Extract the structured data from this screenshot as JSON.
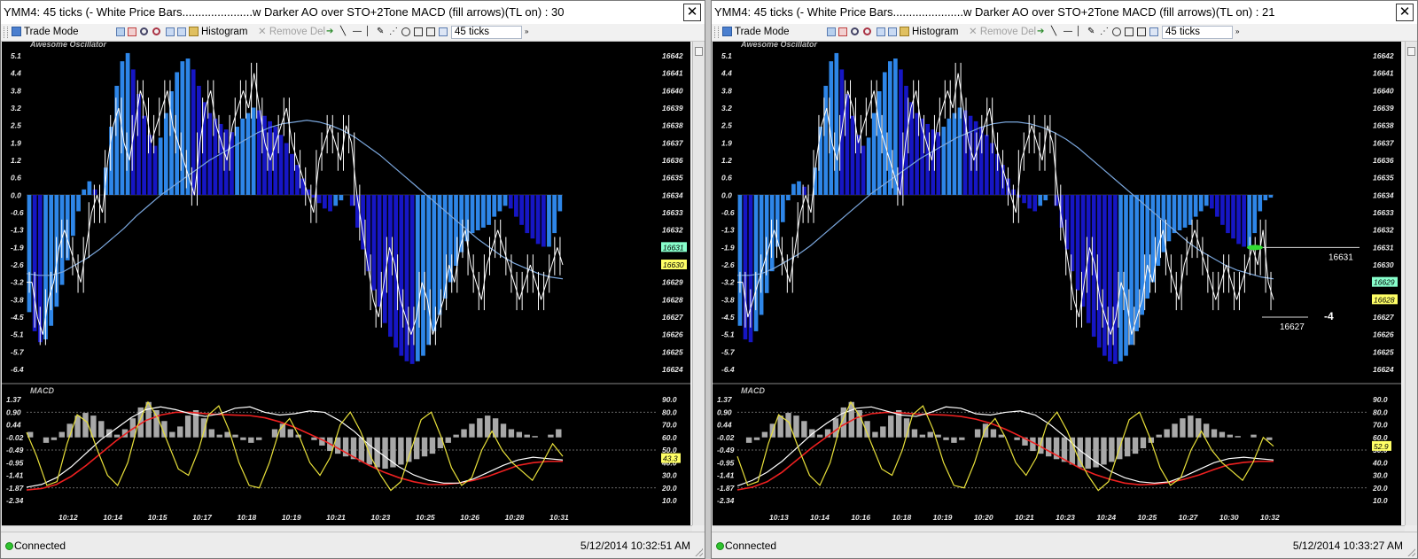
{
  "windows": [
    {
      "title": "YMM4: 45 ticks (- White Price Bars......................w Darker AO  over STO+2Tone MACD (fill arrows)(TL on) : 30",
      "toolbar": {
        "trade_mode": "Trade Mode",
        "histogram": "Histogram",
        "remove_del": "Remove Del",
        "interval": "45 ticks"
      },
      "status": "Connected",
      "timestamp": "5/12/2014 10:32:51 AM",
      "close_glyph": "✕"
    },
    {
      "title": "YMM4: 45 ticks (- White Price Bars......................w Darker AO  over STO+2Tone MACD (fill arrows)(TL on) : 21",
      "toolbar": {
        "trade_mode": "Trade Mode",
        "histogram": "Histogram",
        "remove_del": "Remove Del",
        "interval": "45 ticks"
      },
      "status": "Connected",
      "timestamp": "5/12/2014 10:33:27 AM",
      "close_glyph": "✕"
    }
  ],
  "colors": {
    "ao_light": "#2e86e8",
    "ao_dark": "#1616c4",
    "price_bar": "#ffffff",
    "ma_line": "#7aa6dc",
    "macd_hist": "#a8a8a8",
    "macd_line": "#ffffff",
    "signal_line": "#ee2020",
    "stoch_line": "#e8e03a",
    "last_price_label": "#ffff66",
    "prev_price_label": "#88ffcc"
  },
  "chart_data": [
    {
      "type": "bar",
      "panel": "Awesome Oscillator + price bars (left)",
      "title": "Awesome Oscillator",
      "left_axis_ticks": [
        "5.1",
        "4.4",
        "3.8",
        "3.2",
        "2.5",
        "1.9",
        "1.2",
        "0.6",
        "0.0",
        "-0.6",
        "-1.3",
        "-1.9",
        "-2.6",
        "-3.2",
        "-3.8",
        "-4.5",
        "-5.1",
        "-5.7",
        "-6.4"
      ],
      "right_axis_ticks": [
        "16642",
        "16641",
        "16640",
        "16639",
        "16638",
        "16637",
        "16636",
        "16635",
        "16634",
        "16633",
        "16632",
        "16631",
        "16630",
        "16629",
        "16628",
        "16627",
        "16626",
        "16625",
        "16624"
      ],
      "ao_ylim": [
        -6.4,
        5.1
      ],
      "price_ylim": [
        16624,
        16642
      ],
      "price_labels": [
        {
          "value": "16631",
          "kind": "prev"
        },
        {
          "value": "16630",
          "kind": "last"
        }
      ],
      "ao_values": [
        -4.3,
        -5.0,
        -5.4,
        -5.3,
        -4.8,
        -4.1,
        -3.3,
        -2.4,
        -1.5,
        -0.6,
        0.2,
        0.5,
        0.2,
        0.0,
        1.0,
        2.5,
        4.0,
        4.9,
        5.2,
        4.6,
        3.7,
        2.9,
        2.2,
        1.8,
        2.1,
        3.0,
        3.8,
        4.5,
        4.9,
        5.0,
        4.6,
        4.0,
        3.4,
        3.0,
        2.8,
        2.6,
        2.4,
        2.3,
        2.5,
        2.8,
        3.0,
        3.2,
        3.1,
        2.9,
        2.7,
        2.5,
        2.2,
        1.9,
        1.5,
        1.1,
        0.6,
        0.2,
        -0.1,
        -0.3,
        -0.5,
        -0.6,
        -0.4,
        -0.2,
        0.0,
        -0.4,
        -1.2,
        -2.0,
        -2.8,
        -3.5,
        -4.1,
        -4.7,
        -5.2,
        -5.6,
        -5.9,
        -6.1,
        -6.2,
        -6.1,
        -5.9,
        -5.5,
        -5.0,
        -4.4,
        -3.8,
        -3.2,
        -2.6,
        -2.1,
        -1.7,
        -1.4,
        -1.3,
        -1.2,
        -1.1,
        -0.8,
        -0.6,
        -0.4,
        -0.5,
        -0.8,
        -1.1,
        -1.4,
        -1.6,
        -1.8,
        -1.9,
        -1.9,
        -1.4,
        -0.6
      ],
      "price_closes": [
        16629,
        16627,
        16626,
        16628,
        16629,
        16631,
        16632,
        16631,
        16630,
        16629,
        16631,
        16633,
        16634,
        16633,
        16636,
        16638,
        16639,
        16637,
        16636,
        16638,
        16640,
        16639,
        16637,
        16638,
        16639,
        16640,
        16638,
        16637,
        16636,
        16635,
        16634,
        16637,
        16639,
        16640,
        16638,
        16637,
        16636,
        16638,
        16639,
        16640,
        16639,
        16641,
        16639,
        16637,
        16636,
        16637,
        16638,
        16639,
        16637,
        16636,
        16635,
        16634,
        16633,
        16636,
        16637,
        16638,
        16637,
        16636,
        16638,
        16637,
        16634,
        16632,
        16630,
        16628,
        16627,
        16629,
        16631,
        16630,
        16628,
        16627,
        16626,
        16627,
        16629,
        16628,
        16626,
        16627,
        16628,
        16630,
        16629,
        16631,
        16632,
        16630,
        16629,
        16628,
        16630,
        16631,
        16632,
        16631,
        16630,
        16629,
        16628,
        16629,
        16630,
        16629,
        16628,
        16629,
        16630,
        16631,
        16630
      ],
      "ma_values": [
        16629.5,
        16629.4,
        16629.4,
        16629.6,
        16630.0,
        16630.4,
        16630.9,
        16631.5,
        16632.1,
        16632.8,
        16633.4,
        16634.0,
        16634.5,
        16635.0,
        16635.5,
        16636.0,
        16636.4,
        16636.8,
        16637.2,
        16637.6,
        16637.9,
        16638.1,
        16638.2,
        16638.3,
        16638.2,
        16638.0,
        16637.7,
        16637.3,
        16636.8,
        16636.3,
        16635.7,
        16635.1,
        16634.5,
        16633.9,
        16633.3,
        16632.7,
        16632.1,
        16631.5,
        16631.0,
        16630.5,
        16630.1,
        16629.8,
        16629.5,
        16629.3,
        16629.2
      ],
      "x_label_ticks": []
    },
    {
      "type": "bar",
      "panel": "MACD + Stochastic (left)",
      "title": "MACD",
      "left_axis_ticks": [
        "1.37",
        "0.90",
        "0.44",
        "-0.02",
        "-0.49",
        "-0.95",
        "-1.41",
        "-1.87",
        "-2.34"
      ],
      "right_axis_ticks": [
        "90.0",
        "80.0",
        "70.0",
        "60.0",
        "50.0",
        "40.0",
        "30.0",
        "20.0",
        "10.0"
      ],
      "macd_ylim": [
        -2.34,
        1.37
      ],
      "stoch_ylim": [
        10,
        90
      ],
      "last_stoch_label": "43.3",
      "x_time_ticks": [
        "10:12",
        "10:14",
        "10:15",
        "10:17",
        "10:18",
        "10:19",
        "10:21",
        "10:23",
        "10:25",
        "10:26",
        "10:28",
        "10:31"
      ],
      "macd_hist": [
        0.2,
        0.0,
        -0.2,
        -0.1,
        0.2,
        0.5,
        0.8,
        0.9,
        0.8,
        0.6,
        0.3,
        0.1,
        0.3,
        0.7,
        1.1,
        1.3,
        1.0,
        0.6,
        0.2,
        0.4,
        0.8,
        1.0,
        0.7,
        0.3,
        0.1,
        0.2,
        0.1,
        -0.1,
        -0.2,
        -0.1,
        0.0,
        0.3,
        0.5,
        0.3,
        0.1,
        0.0,
        -0.1,
        -0.3,
        -0.5,
        -0.6,
        -0.7,
        -0.8,
        -0.9,
        -1.0,
        -1.1,
        -1.15,
        -1.1,
        -1.0,
        -0.9,
        -0.8,
        -0.7,
        -0.6,
        -0.4,
        -0.2,
        0.1,
        0.3,
        0.5,
        0.7,
        0.8,
        0.7,
        0.5,
        0.3,
        0.2,
        0.1,
        0.05,
        0.0,
        0.1,
        0.3
      ],
      "macd_line": [
        -1.85,
        -1.75,
        -1.5,
        -1.1,
        -0.6,
        -0.1,
        0.3,
        0.7,
        1.0,
        1.1,
        1.0,
        0.85,
        0.75,
        0.85,
        1.05,
        1.1,
        0.9,
        0.8,
        0.85,
        0.95,
        0.9,
        0.6,
        0.2,
        -0.3,
        -0.7,
        -1.1,
        -1.4,
        -1.6,
        -1.7,
        -1.7,
        -1.55,
        -1.3,
        -1.05,
        -0.85,
        -0.75,
        -0.8,
        -0.85
      ],
      "signal_line": [
        -1.95,
        -1.9,
        -1.75,
        -1.45,
        -1.05,
        -0.6,
        -0.15,
        0.25,
        0.6,
        0.8,
        0.9,
        0.9,
        0.85,
        0.82,
        0.8,
        0.78,
        0.7,
        0.55,
        0.35,
        0.1,
        -0.15,
        -0.45,
        -0.75,
        -1.05,
        -1.3,
        -1.5,
        -1.65,
        -1.75,
        -1.75,
        -1.7,
        -1.6,
        -1.45,
        -1.25,
        -1.05,
        -0.95,
        -0.9,
        -0.9
      ],
      "stoch_line": [
        64,
        45,
        22,
        25,
        55,
        78,
        72,
        50,
        30,
        22,
        40,
        70,
        88,
        75,
        55,
        35,
        30,
        50,
        78,
        85,
        66,
        40,
        22,
        20,
        40,
        66,
        75,
        60,
        40,
        30,
        44,
        70,
        80,
        65,
        45,
        30,
        18,
        25,
        50,
        74,
        80,
        60,
        36,
        22,
        28,
        50,
        65,
        50,
        40,
        33,
        26,
        40,
        55,
        45
      ]
    },
    {
      "type": "bar",
      "panel": "Awesome Oscillator + price bars (right)",
      "title": "Awesome Oscillator",
      "left_axis_ticks": [
        "5.1",
        "4.4",
        "3.8",
        "3.2",
        "2.5",
        "1.9",
        "1.2",
        "0.6",
        "0.0",
        "-0.6",
        "-1.3",
        "-1.9",
        "-2.6",
        "-3.2",
        "-3.8",
        "-4.5",
        "-5.1",
        "-5.7",
        "-6.4"
      ],
      "right_axis_ticks": [
        "16642",
        "16641",
        "16640",
        "16639",
        "16638",
        "16637",
        "16636",
        "16635",
        "16634",
        "16633",
        "16632",
        "16631",
        "16630",
        "16629",
        "16628",
        "16627",
        "16626",
        "16625",
        "16624"
      ],
      "ao_ylim": [
        -6.4,
        5.1
      ],
      "price_ylim": [
        16624,
        16642
      ],
      "price_labels": [
        {
          "value": "16629",
          "kind": "prev"
        },
        {
          "value": "16628",
          "kind": "last"
        }
      ],
      "annotations": {
        "upper_line": "16631",
        "lower_line": "16627",
        "diff": "-4"
      },
      "ao_values": [
        -4.8,
        -5.3,
        -5.4,
        -5.0,
        -4.4,
        -3.6,
        -2.8,
        -1.9,
        -1.0,
        -0.2,
        0.4,
        0.5,
        0.3,
        0.0,
        1.0,
        2.5,
        4.0,
        4.9,
        5.2,
        4.6,
        3.7,
        2.9,
        2.2,
        1.8,
        2.1,
        3.0,
        3.8,
        4.5,
        4.9,
        5.0,
        4.6,
        4.0,
        3.4,
        3.0,
        2.8,
        2.6,
        2.4,
        2.3,
        2.5,
        2.8,
        3.0,
        3.2,
        3.1,
        2.9,
        2.7,
        2.5,
        2.2,
        1.9,
        1.5,
        1.1,
        0.6,
        0.2,
        -0.1,
        -0.3,
        -0.5,
        -0.6,
        -0.4,
        -0.2,
        0.0,
        -0.4,
        -1.2,
        -2.0,
        -2.8,
        -3.5,
        -4.1,
        -4.7,
        -5.2,
        -5.6,
        -5.9,
        -6.1,
        -6.2,
        -6.1,
        -5.9,
        -5.5,
        -5.0,
        -4.4,
        -3.8,
        -3.2,
        -2.6,
        -2.1,
        -1.7,
        -1.4,
        -1.3,
        -1.2,
        -1.1,
        -0.8,
        -0.6,
        -0.4,
        -0.5,
        -0.8,
        -1.1,
        -1.4,
        -1.6,
        -1.8,
        -1.9,
        -1.9,
        -1.4,
        -0.6,
        -0.2,
        -0.1
      ],
      "price_closes": [
        16629,
        16627,
        16628,
        16629,
        16630,
        16631,
        16632,
        16631,
        16630,
        16629,
        16631,
        16633,
        16634,
        16633,
        16636,
        16638,
        16639,
        16637,
        16636,
        16638,
        16640,
        16639,
        16637,
        16638,
        16639,
        16640,
        16638,
        16637,
        16636,
        16635,
        16634,
        16637,
        16639,
        16640,
        16638,
        16637,
        16636,
        16638,
        16639,
        16640,
        16639,
        16641,
        16639,
        16637,
        16636,
        16637,
        16638,
        16639,
        16637,
        16636,
        16635,
        16634,
        16633,
        16636,
        16637,
        16638,
        16637,
        16636,
        16638,
        16637,
        16634,
        16632,
        16630,
        16628,
        16627,
        16629,
        16631,
        16630,
        16628,
        16627,
        16626,
        16627,
        16629,
        16628,
        16626,
        16627,
        16628,
        16630,
        16629,
        16631,
        16632,
        16630,
        16629,
        16628,
        16630,
        16631,
        16632,
        16631,
        16630,
        16629,
        16628,
        16629,
        16630,
        16629,
        16628,
        16629,
        16630,
        16631,
        16630,
        16632,
        16629,
        16628
      ],
      "ma_values": [
        16629.4,
        16629.4,
        16629.5,
        16629.8,
        16630.2,
        16630.6,
        16631.1,
        16631.7,
        16632.3,
        16632.9,
        16633.5,
        16634.1,
        16634.6,
        16635.1,
        16635.6,
        16636.1,
        16636.5,
        16636.9,
        16637.3,
        16637.6,
        16637.9,
        16638.1,
        16638.2,
        16638.2,
        16638.1,
        16637.9,
        16637.6,
        16637.2,
        16636.7,
        16636.1,
        16635.5,
        16634.9,
        16634.3,
        16633.7,
        16633.1,
        16632.5,
        16631.9,
        16631.3,
        16630.8,
        16630.4,
        16630.0,
        16629.7,
        16629.5,
        16629.3,
        16629.2
      ],
      "x_label_ticks": []
    },
    {
      "type": "bar",
      "panel": "MACD + Stochastic (right)",
      "title": "MACD",
      "left_axis_ticks": [
        "1.37",
        "0.90",
        "0.44",
        "-0.02",
        "-0.49",
        "-0.95",
        "-1.41",
        "-1.87",
        "-2.34"
      ],
      "right_axis_ticks": [
        "90.0",
        "80.0",
        "70.0",
        "60.0",
        "50.0",
        "40.0",
        "30.0",
        "20.0",
        "10.0"
      ],
      "macd_ylim": [
        -2.34,
        1.37
      ],
      "stoch_ylim": [
        10,
        90
      ],
      "last_stoch_label": "52.9",
      "x_time_ticks": [
        "10:13",
        "10:14",
        "10:16",
        "10:18",
        "10:19",
        "10:20",
        "10:21",
        "10:23",
        "10:24",
        "10:25",
        "10:27",
        "10:30",
        "10:32"
      ],
      "macd_hist": [
        0.0,
        -0.2,
        -0.1,
        0.2,
        0.5,
        0.8,
        0.9,
        0.8,
        0.6,
        0.3,
        0.1,
        0.3,
        0.7,
        1.1,
        1.3,
        1.0,
        0.6,
        0.2,
        0.4,
        0.8,
        1.0,
        0.7,
        0.3,
        0.1,
        0.2,
        0.1,
        -0.1,
        -0.2,
        -0.1,
        0.0,
        0.3,
        0.5,
        0.3,
        0.1,
        0.0,
        -0.1,
        -0.3,
        -0.5,
        -0.6,
        -0.7,
        -0.8,
        -0.9,
        -1.0,
        -1.1,
        -1.15,
        -1.1,
        -1.0,
        -0.9,
        -0.8,
        -0.7,
        -0.6,
        -0.4,
        -0.2,
        0.1,
        0.3,
        0.5,
        0.7,
        0.8,
        0.7,
        0.5,
        0.3,
        0.2,
        0.1,
        0.05,
        0.0,
        0.1,
        0.0,
        -0.1
      ],
      "macd_line": [
        -1.8,
        -1.6,
        -1.3,
        -0.9,
        -0.4,
        0.1,
        0.5,
        0.85,
        1.05,
        1.1,
        0.95,
        0.8,
        0.75,
        0.9,
        1.1,
        1.05,
        0.85,
        0.8,
        0.9,
        0.95,
        0.8,
        0.45,
        0.0,
        -0.5,
        -0.9,
        -1.25,
        -1.5,
        -1.65,
        -1.7,
        -1.65,
        -1.45,
        -1.2,
        -0.95,
        -0.8,
        -0.75,
        -0.8,
        -0.85
      ],
      "signal_line": [
        -1.95,
        -1.85,
        -1.65,
        -1.3,
        -0.85,
        -0.4,
        0.0,
        0.4,
        0.7,
        0.85,
        0.9,
        0.88,
        0.84,
        0.82,
        0.8,
        0.75,
        0.65,
        0.5,
        0.28,
        0.02,
        -0.25,
        -0.55,
        -0.85,
        -1.15,
        -1.38,
        -1.56,
        -1.7,
        -1.76,
        -1.74,
        -1.68,
        -1.56,
        -1.4,
        -1.2,
        -1.02,
        -0.94,
        -0.9,
        -0.9
      ],
      "stoch_line": [
        45,
        22,
        25,
        55,
        78,
        72,
        50,
        30,
        22,
        40,
        70,
        88,
        75,
        55,
        35,
        30,
        50,
        78,
        85,
        66,
        40,
        22,
        20,
        40,
        66,
        75,
        60,
        40,
        30,
        44,
        70,
        80,
        65,
        45,
        30,
        18,
        25,
        50,
        74,
        80,
        60,
        36,
        22,
        28,
        50,
        65,
        50,
        40,
        33,
        26,
        40,
        60,
        53
      ]
    }
  ]
}
